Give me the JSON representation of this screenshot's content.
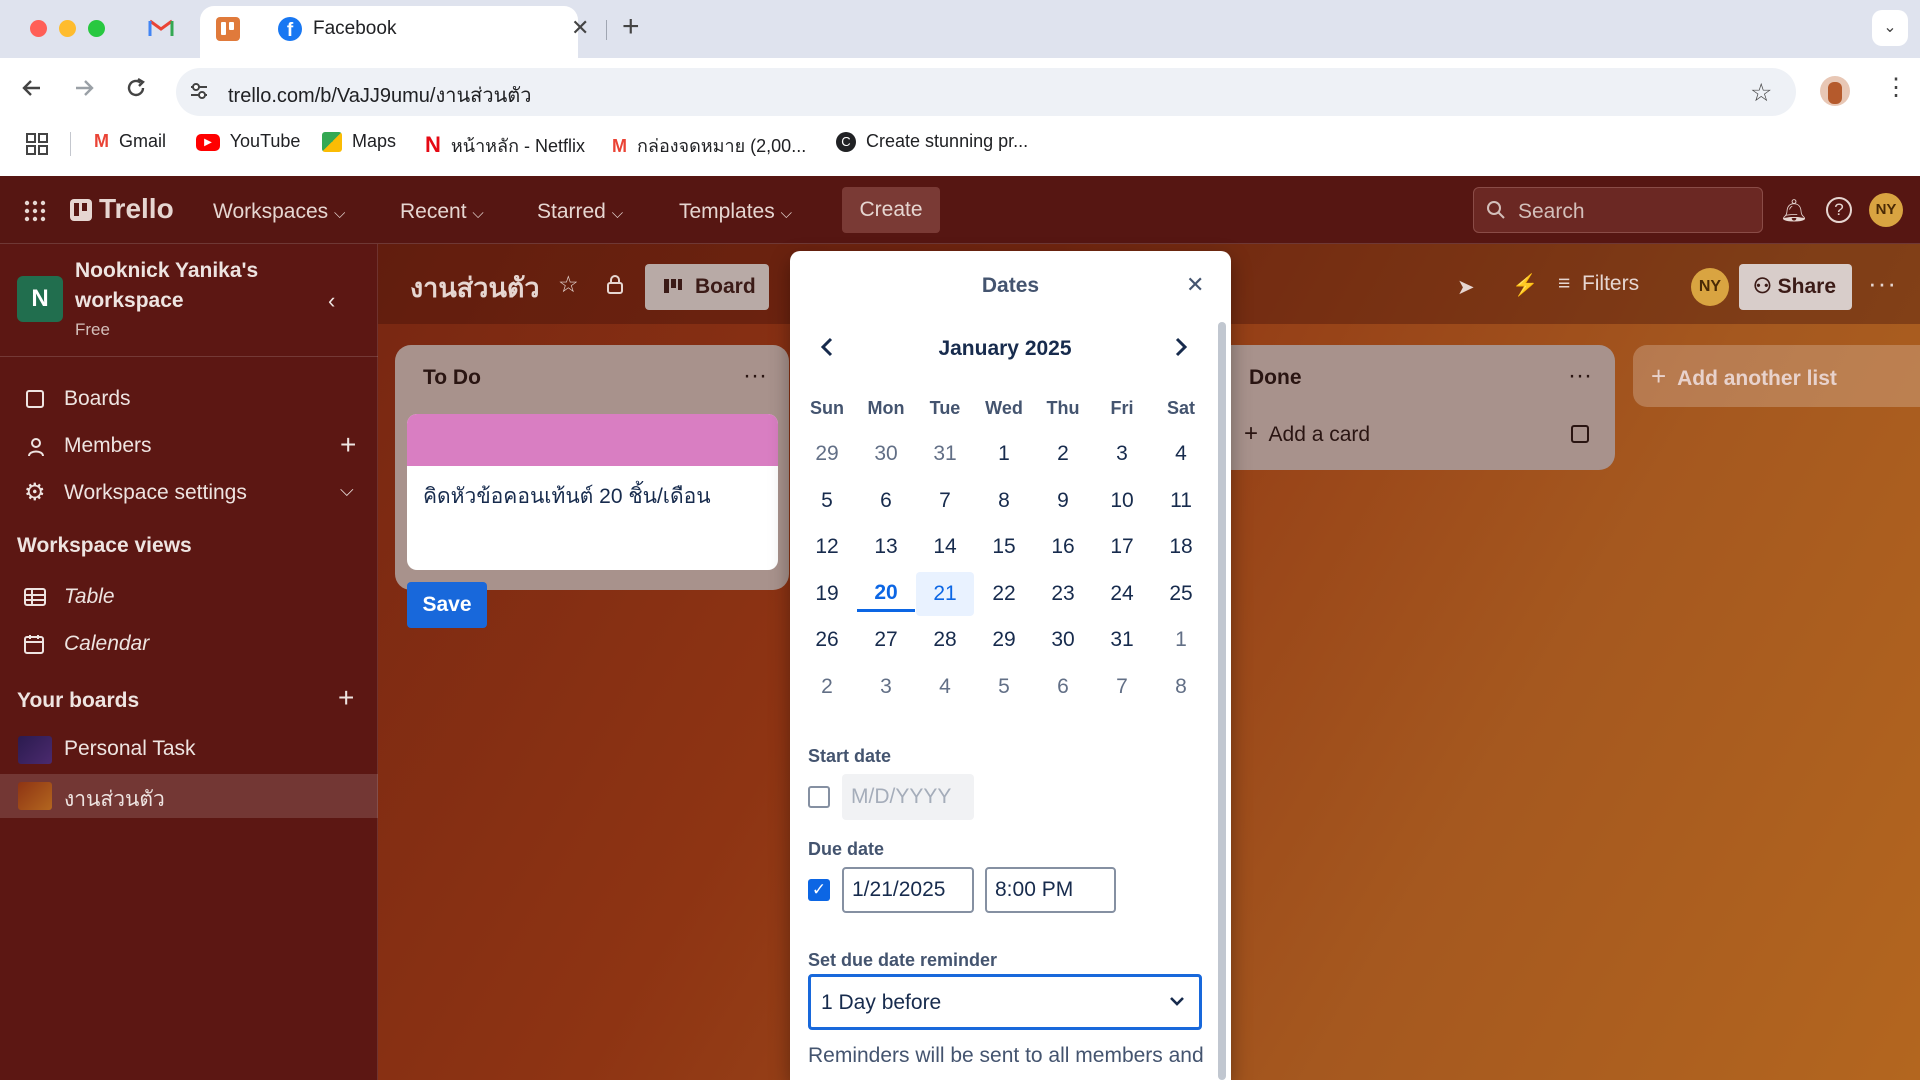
{
  "browser": {
    "tab_title": "Facebook",
    "url": "trello.com/b/VaJJ9umu/งานส่วนตัว",
    "bookmarks": [
      {
        "label": "Gmail",
        "icon": "gmail-icon"
      },
      {
        "label": "YouTube",
        "icon": "youtube-icon"
      },
      {
        "label": "Maps",
        "icon": "maps-icon"
      },
      {
        "label": "หน้าหลัก - Netflix",
        "icon": "netflix-icon"
      },
      {
        "label": "กล่องจดหมาย (2,00...",
        "icon": "gmail-icon"
      },
      {
        "label": "Create stunning pr...",
        "icon": "canva-icon"
      }
    ]
  },
  "header": {
    "logo": "Trello",
    "nav": [
      "Workspaces",
      "Recent",
      "Starred",
      "Templates"
    ],
    "create": "Create",
    "search_placeholder": "Search",
    "avatar": "NY"
  },
  "sidebar": {
    "workspace_initial": "N",
    "workspace_name_line1": "Nooknick Yanika's",
    "workspace_name_line2": "workspace",
    "plan": "Free",
    "items": [
      "Boards",
      "Members",
      "Workspace settings"
    ],
    "views_heading": "Workspace views",
    "views": [
      "Table",
      "Calendar"
    ],
    "boards_heading": "Your boards",
    "boards": [
      "Personal Task",
      "งานส่วนตัว"
    ]
  },
  "board": {
    "title": "งานส่วนตัว",
    "view": "Board",
    "filters": "Filters",
    "avatar": "NY",
    "share": "Share",
    "add_list": "Add another list"
  },
  "lists": {
    "todo_title": "To Do",
    "card_text": "คิดหัวข้อคอนเท้นต์ 20 ชิ้น/เดือน",
    "save": "Save",
    "done_title": "Done",
    "add_card": "Add a card"
  },
  "dates": {
    "title": "Dates",
    "month": "January 2025",
    "weekdays": [
      "Sun",
      "Mon",
      "Tue",
      "Wed",
      "Thu",
      "Fri",
      "Sat"
    ],
    "weeks": [
      [
        "29",
        "30",
        "31",
        "1",
        "2",
        "3",
        "4"
      ],
      [
        "5",
        "6",
        "7",
        "8",
        "9",
        "10",
        "11"
      ],
      [
        "12",
        "13",
        "14",
        "15",
        "16",
        "17",
        "18"
      ],
      [
        "19",
        "20",
        "21",
        "22",
        "23",
        "24",
        "25"
      ],
      [
        "26",
        "27",
        "28",
        "29",
        "30",
        "31",
        "1"
      ],
      [
        "2",
        "3",
        "4",
        "5",
        "6",
        "7",
        "8"
      ]
    ],
    "today": "20",
    "selected": "21",
    "start_label": "Start date",
    "start_placeholder": "M/D/YYYY",
    "start_checked": false,
    "due_label": "Due date",
    "due_date": "1/21/2025",
    "due_time": "8:00 PM",
    "due_checked": true,
    "reminder_label": "Set due date reminder",
    "reminder_value": "1 Day before",
    "reminder_note": "Reminders will be sent to all members and"
  },
  "colors": {
    "card_label": "#d97ec2",
    "primary": "#1868db",
    "today": "#0c66e4",
    "selected_bg": "#e9f2ff",
    "workspace_badge": "#216e4e"
  }
}
